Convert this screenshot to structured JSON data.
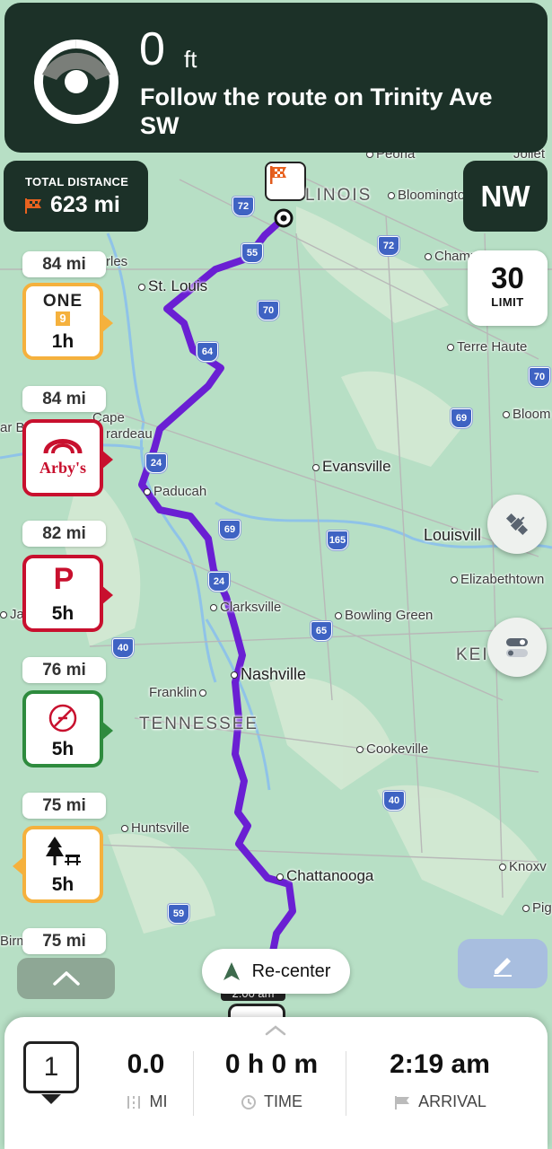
{
  "banner": {
    "distance": "0",
    "unit": "ft",
    "instruction": "Follow the route on Trinity Ave SW"
  },
  "total": {
    "label": "TOTAL DISTANCE",
    "value": "623 mi"
  },
  "compass": "NW",
  "speed_limit": {
    "value": "30",
    "label": "LIMIT"
  },
  "map_labels": {
    "peoria": "Peoria",
    "joliet": "Joliet",
    "illinois": "LINOIS",
    "bloomington": "Bloomingto",
    "charleston": "rles",
    "champ": "Champ",
    "stlouis": "St. Louis",
    "terre_haute": "Terre Haute",
    "bloom": "Bloom",
    "cape1": "Cape",
    "cape2": "rardeau",
    "arbl": "ar Bl",
    "evansville": "Evansville",
    "paducah": "Paducah",
    "louisville": "Louisvill",
    "elizabethtown": "Elizabethtown",
    "ja": "Ja",
    "clarksville": "Clarksville",
    "bowling_green": "Bowling Green",
    "ken": "KEI",
    "nashville": "Nashville",
    "franklin": "Franklin",
    "tennessee": "TENNESSEE",
    "cookeville": "Cookeville",
    "huntsville": "Huntsville",
    "chattanooga": "Chattanooga",
    "knox": "Knoxv",
    "pig": "Pig",
    "birm": "Birm",
    "time_tag": "2:00 am"
  },
  "shields": [
    "72",
    "55",
    "72",
    "70",
    "64",
    "70",
    "69",
    "24",
    "69",
    "165",
    "24",
    "65",
    "40",
    "40",
    "59"
  ],
  "pois": [
    {
      "distance": "84 mi",
      "brand": "ONE 9",
      "time": "1h",
      "color": "#f5b13d"
    },
    {
      "distance": "84 mi",
      "brand": "Arby's",
      "time": "",
      "color": "#c8102e"
    },
    {
      "distance": "82 mi",
      "brand": "P",
      "time": "5h",
      "color": "#c8102e"
    },
    {
      "distance": "76 mi",
      "brand": "Loves-style stop",
      "time": "5h",
      "color": "#2e8b3e"
    },
    {
      "distance": "75 mi",
      "brand": "rest-area",
      "time": "5h",
      "color": "#f5b13d"
    },
    {
      "distance": "75 mi",
      "brand": "",
      "time": "",
      "color": ""
    }
  ],
  "recenter_label": "Re-center",
  "bottom": {
    "step": "1",
    "miles": {
      "value": "0.0",
      "label": "MI"
    },
    "time": {
      "value": "0 h 0 m",
      "label": "TIME"
    },
    "arrival": {
      "value": "2:19 am",
      "label": "ARRIVAL"
    }
  }
}
